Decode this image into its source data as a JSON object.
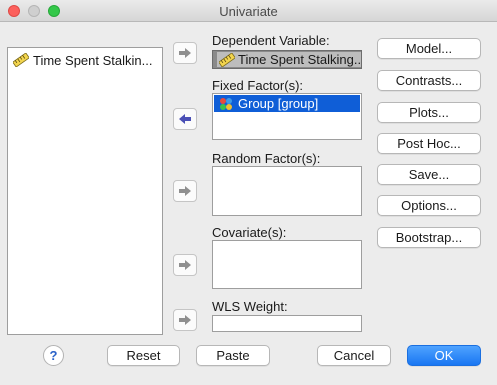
{
  "window": {
    "title": "Univariate"
  },
  "source_list": {
    "items": [
      {
        "label": "Time Spent Stalkin...",
        "icon": "scale-ruler-icon"
      }
    ]
  },
  "dependent": {
    "label": "Dependent Variable:",
    "value": "Time Spent Stalking...",
    "icon": "scale-ruler-icon"
  },
  "fixed_factors": {
    "label": "Fixed Factor(s):",
    "items": [
      {
        "label": "Group [group]",
        "icon": "nominal-variable-icon",
        "selected": true
      }
    ]
  },
  "random_factors": {
    "label": "Random Factor(s):"
  },
  "covariates": {
    "label": "Covariate(s):"
  },
  "wls_weight": {
    "label": "WLS Weight:",
    "value": ""
  },
  "side_buttons": {
    "model": "Model...",
    "contrasts": "Contrasts...",
    "plots": "Plots...",
    "post_hoc": "Post Hoc...",
    "save": "Save...",
    "options": "Options...",
    "bootstrap": "Bootstrap..."
  },
  "bottom_buttons": {
    "help": "?",
    "reset": "Reset",
    "paste": "Paste",
    "cancel": "Cancel",
    "ok": "OK"
  },
  "colors": {
    "selection": "#0f5ed7",
    "ok_button": "#1976f2",
    "arrow_gray": "#8f8f8f",
    "arrow_blue": "#4a4fb5"
  }
}
